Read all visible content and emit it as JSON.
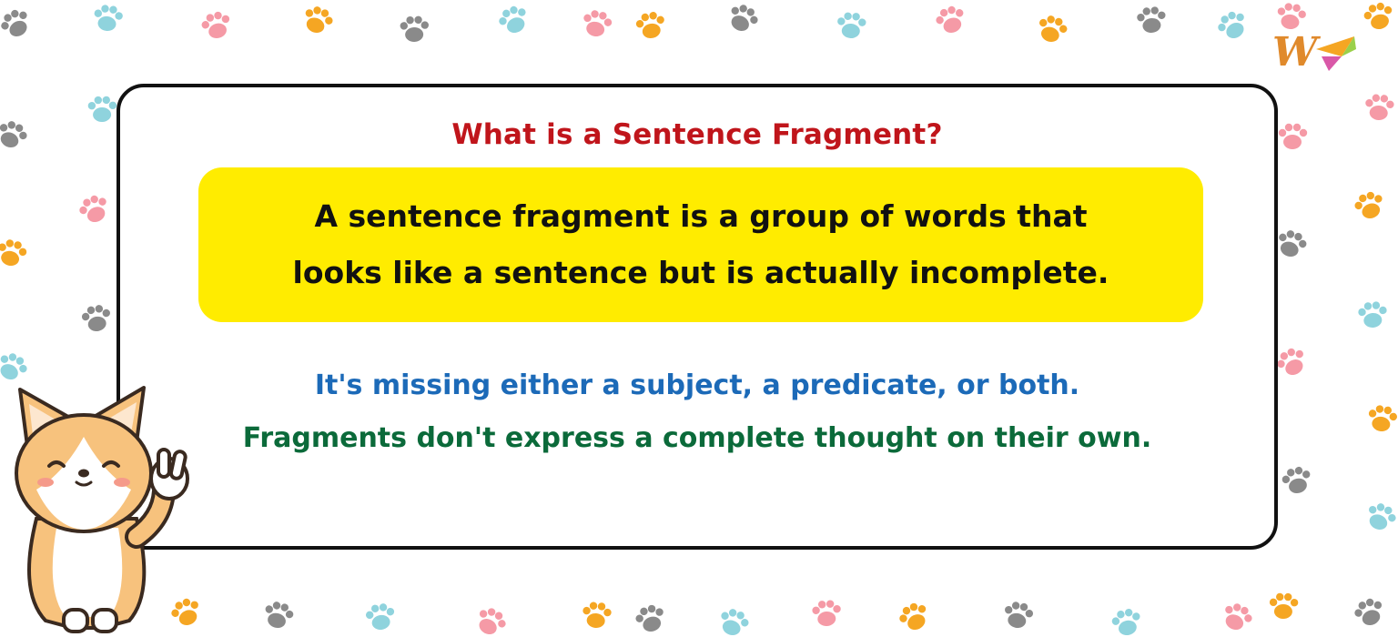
{
  "card": {
    "title": "What is a Sentence Fragment?",
    "definition": {
      "line1": "A sentence fragment is a group of words that",
      "line2": "looks like a sentence but is actually incomplete."
    },
    "point1": "It's missing either a subject, a predicate, or both.",
    "point2": "Fragments don't express a complete thought on their own."
  },
  "logo": {
    "letter": "W"
  },
  "colors": {
    "title": "#c0151b",
    "definition_box": "#ffec00",
    "point1": "#1c6ab8",
    "point2": "#0b6a3a",
    "paws": [
      "#8a8a8a",
      "#8fd3dd",
      "#f59aa6",
      "#f5a623"
    ]
  },
  "icons": {
    "background": "paw-print-icon",
    "mascot": "corgi-mascot-icon",
    "logo": "brand-logo-icon"
  }
}
